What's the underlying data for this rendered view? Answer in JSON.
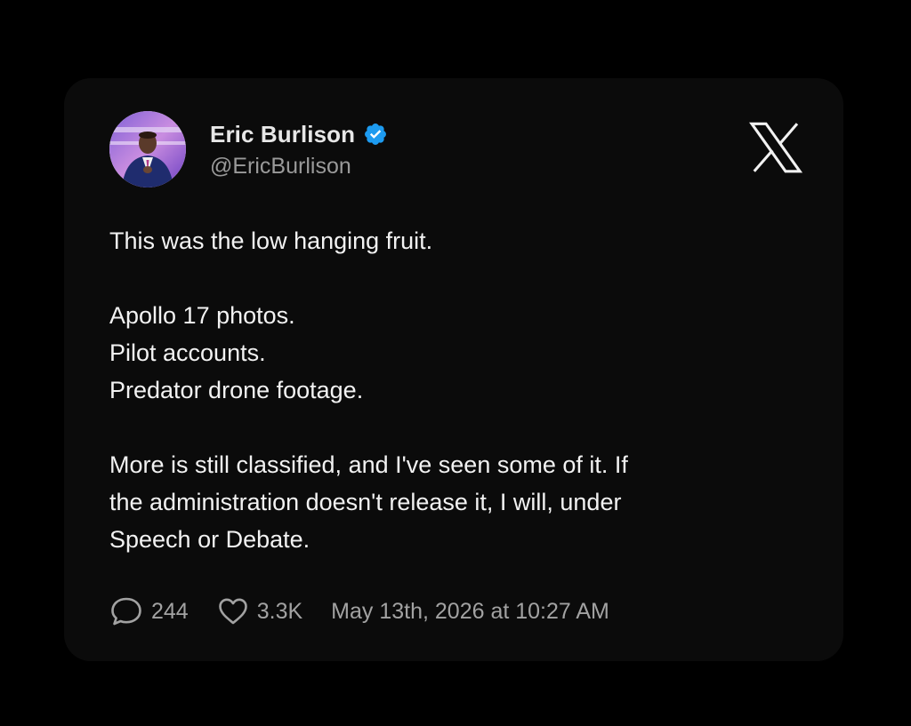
{
  "post": {
    "author_name": "Eric Burlison",
    "author_handle": "@EricBurlison",
    "verified": true,
    "lines": [
      "This was the low hanging fruit.",
      "",
      "Apollo 17 photos.",
      "Pilot accounts.",
      "Predator drone footage.",
      "",
      "More is still classified, and I've seen some of it. If",
      "the administration doesn't release it, I will, under",
      "Speech or Debate."
    ],
    "replies": "244",
    "likes": "3.3K",
    "timestamp": "May 13th, 2026 at 10:27 AM"
  },
  "icons": {
    "brand": "x-logo-icon",
    "verified": "verified-badge-icon",
    "reply": "speech-bubble-icon",
    "like": "heart-icon"
  },
  "colors": {
    "background": "#000000",
    "card": "#0b0b0b",
    "text": "#f2f2f2",
    "muted": "#a2a2a2",
    "verified_blue": "#1d9bf0"
  }
}
